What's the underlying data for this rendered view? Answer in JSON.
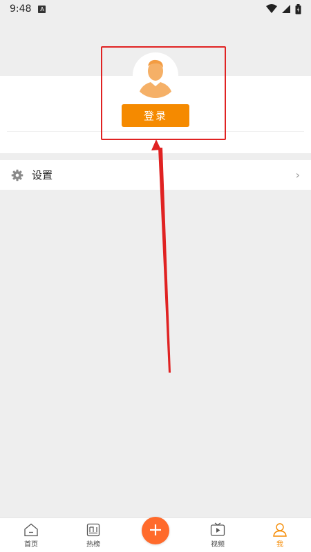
{
  "status_bar": {
    "time": "9:48",
    "notification_icon": "A",
    "icons": [
      "wifi-icon",
      "signal-icon",
      "battery-icon"
    ]
  },
  "profile": {
    "login_label": "登录",
    "avatar_icon": "person-icon"
  },
  "settings": {
    "label": "设置",
    "icon": "gear-icon",
    "chevron": "›"
  },
  "tabs": [
    {
      "label": "首页",
      "icon": "home-icon"
    },
    {
      "label": "热榜",
      "icon": "hot-list-icon"
    },
    {
      "label": "",
      "icon": "plus-icon"
    },
    {
      "label": "视频",
      "icon": "video-icon"
    },
    {
      "label": "我",
      "icon": "person-icon"
    }
  ],
  "colors": {
    "accent": "#f58a00",
    "add_button": "#ff6a2b",
    "annotation": "#e02222",
    "background": "#eeeeee"
  }
}
